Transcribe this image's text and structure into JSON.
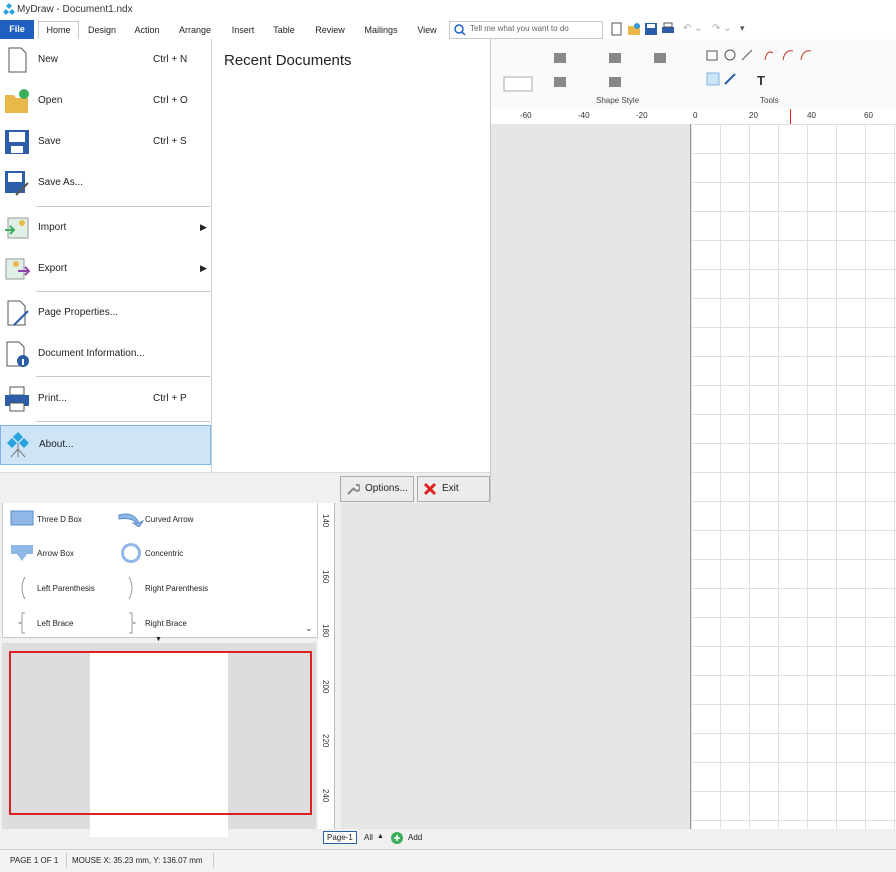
{
  "app": {
    "title": "MyDraw - Document1.ndx"
  },
  "tabs": [
    "File",
    "Home",
    "Design",
    "Action",
    "Arrange",
    "Insert",
    "Table",
    "Review",
    "Mailings",
    "View"
  ],
  "search": {
    "placeholder": "Tell me what you want to do"
  },
  "ribbon": {
    "group_shape_style": "Shape Style",
    "group_tools": "Tools"
  },
  "ruler": {
    "h_ticks": [
      "-60",
      "-40",
      "-20",
      "0",
      "20",
      "40",
      "60"
    ],
    "v_ticks": [
      "140",
      "160",
      "180",
      "200",
      "220",
      "240"
    ]
  },
  "backstage": {
    "menu": [
      {
        "label": "New",
        "shortcut": "Ctrl + N",
        "icon": "new-document-icon"
      },
      {
        "label": "Open",
        "shortcut": "Ctrl + O",
        "icon": "open-folder-icon"
      },
      {
        "label": "Save",
        "shortcut": "Ctrl + S",
        "icon": "save-disk-icon"
      },
      {
        "label": "Save As...",
        "shortcut": "",
        "icon": "save-as-icon"
      },
      {
        "label": "Import",
        "shortcut": "",
        "icon": "import-icon"
      },
      {
        "label": "Export",
        "shortcut": "",
        "icon": "export-icon"
      },
      {
        "label": "Page Properties...",
        "shortcut": "",
        "icon": "page-properties-icon"
      },
      {
        "label": "Document Information...",
        "shortcut": "",
        "icon": "document-info-icon"
      },
      {
        "label": "Print...",
        "shortcut": "Ctrl + P",
        "icon": "printer-icon"
      },
      {
        "label": "About...",
        "shortcut": "",
        "icon": "about-logo-icon"
      }
    ],
    "recent_title": "Recent Documents",
    "options_label": "Options...",
    "exit_label": "Exit"
  },
  "shapes": [
    {
      "label": "Three D Box"
    },
    {
      "label": "Curved Arrow"
    },
    {
      "label": "Arrow Box"
    },
    {
      "label": "Concentric"
    },
    {
      "label": "Left Parenthesis"
    },
    {
      "label": "Right Parenthesis"
    },
    {
      "label": "Left Brace"
    },
    {
      "label": "Right Brace"
    }
  ],
  "pages": {
    "current": "Page-1",
    "all_label": "All",
    "add_label": "Add"
  },
  "status": {
    "page": "PAGE 1 OF 1",
    "mouse": "MOUSE X: 35.23 mm, Y: 136.07 mm"
  },
  "colors": {
    "accent": "#1f5fbf",
    "selection": "#e02020"
  }
}
